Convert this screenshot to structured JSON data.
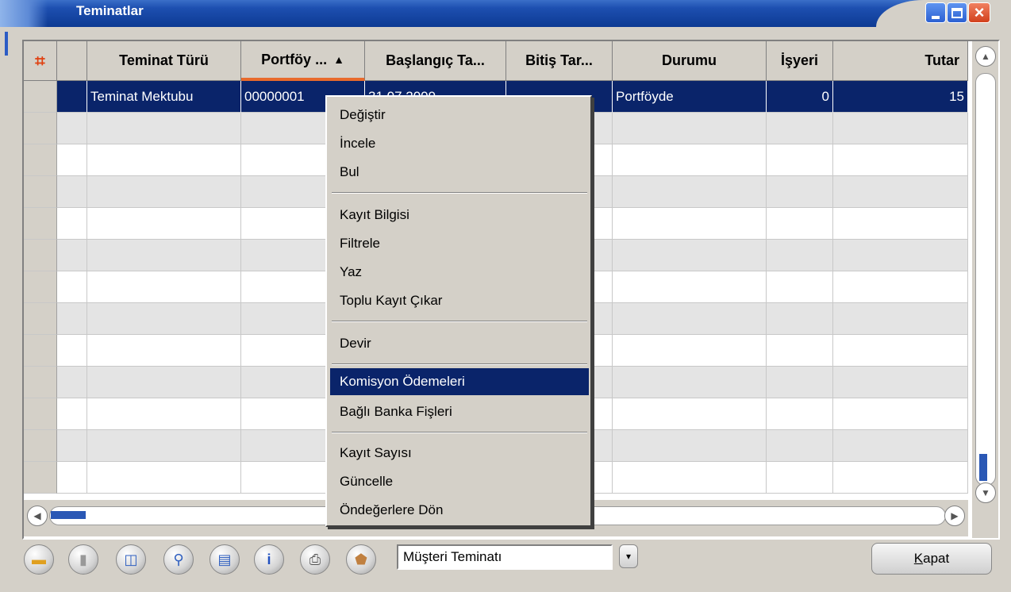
{
  "window": {
    "title": "Teminatlar"
  },
  "grid": {
    "columns": [
      "Teminat Türü",
      "Portföy ...",
      "Başlangıç Ta...",
      "Bitiş Tar...",
      "Durumu",
      "İşyeri",
      "Tutar"
    ],
    "sorted_column": "Portföy ...",
    "selected_row": {
      "teminat_turu": "Teminat Mektubu",
      "portfoy": "00000001",
      "baslangic": "31.07.2009",
      "bitis": "",
      "durumu": "Portföyde",
      "isyeri": "0",
      "tutar": "15"
    }
  },
  "context_menu": {
    "items": [
      "Değiştir",
      "İncele",
      "Bul",
      "Kayıt Bilgisi",
      "Filtrele",
      "Yaz",
      "Toplu Kayıt Çıkar",
      "Devir",
      "Komisyon Ödemeleri",
      "Bağlı Banka Fişleri",
      "Kayıt Sayısı",
      "Güncelle",
      "Öndeğerlere Dön"
    ],
    "highlighted": "Komisyon Ödemeleri"
  },
  "toolbar": {
    "icons": [
      "open-folder-icon",
      "trash-icon",
      "preview-icon",
      "search-icon",
      "report-icon",
      "info-icon",
      "print-icon",
      "filter-icon"
    ],
    "combo_value": "Müşteri Teminatı",
    "close_label_prefix": "",
    "close_label_mnemonic": "K",
    "close_label_rest": "apat"
  },
  "colors": {
    "selection": "#0a246a",
    "titlebar": "#1d4fb0",
    "sort_indicator": "#e86a2c"
  }
}
